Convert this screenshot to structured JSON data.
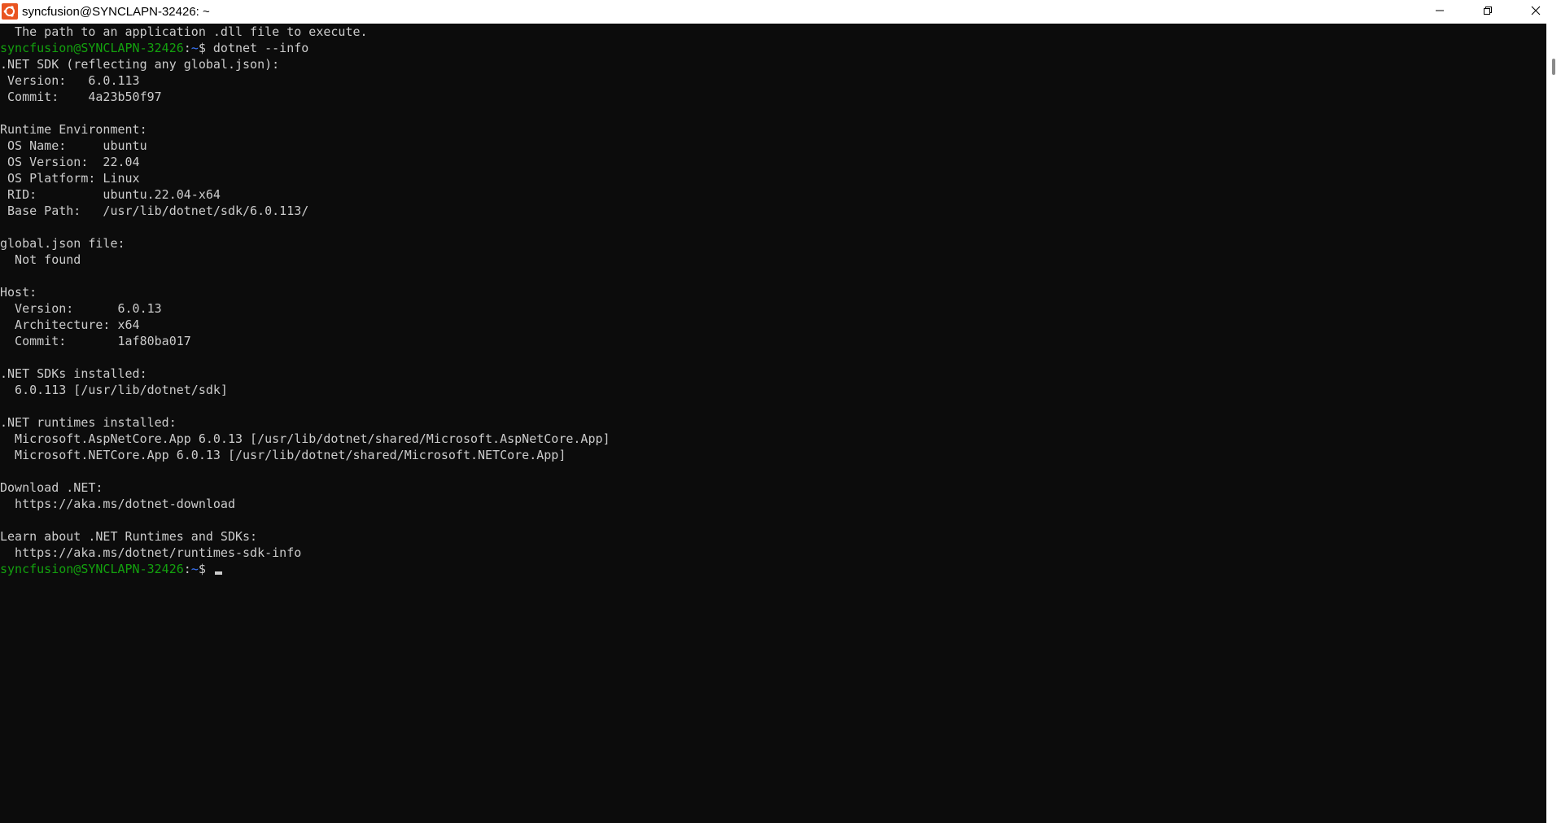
{
  "window": {
    "title": "syncfusion@SYNCLAPN-32426: ~",
    "icon": "ubuntu-logo-icon",
    "controls": {
      "minimize": "minimize-icon",
      "maximize": "restore-icon",
      "close": "close-icon"
    }
  },
  "colors": {
    "background": "#0c0c0c",
    "text": "#cccccc",
    "prompt_user": "#13a10e",
    "prompt_path": "#3b78ff",
    "app_icon": "#e95420"
  },
  "terminal": {
    "lines": [
      "  The path to an application .dll file to execute.",
      "",
      ".NET SDK (reflecting any global.json):",
      " Version:   6.0.113",
      " Commit:    4a23b50f97",
      "",
      "Runtime Environment:",
      " OS Name:     ubuntu",
      " OS Version:  22.04",
      " OS Platform: Linux",
      " RID:         ubuntu.22.04-x64",
      " Base Path:   /usr/lib/dotnet/sdk/6.0.113/",
      "",
      "global.json file:",
      "  Not found",
      "",
      "Host:",
      "  Version:      6.0.13",
      "  Architecture: x64",
      "  Commit:       1af80ba017",
      "",
      ".NET SDKs installed:",
      "  6.0.113 [/usr/lib/dotnet/sdk]",
      "",
      ".NET runtimes installed:",
      "  Microsoft.AspNetCore.App 6.0.13 [/usr/lib/dotnet/shared/Microsoft.AspNetCore.App]",
      "  Microsoft.NETCore.App 6.0.13 [/usr/lib/dotnet/shared/Microsoft.NETCore.App]",
      "",
      "Download .NET:",
      "  https://aka.ms/dotnet-download",
      "",
      "Learn about .NET Runtimes and SDKs:",
      "  https://aka.ms/dotnet/runtimes-sdk-info",
      ""
    ],
    "prompt": {
      "user_host": "syncfusion@SYNCLAPN-32426",
      "separator": ":",
      "path": "~",
      "symbol": "$"
    },
    "command": "dotnet --info"
  }
}
